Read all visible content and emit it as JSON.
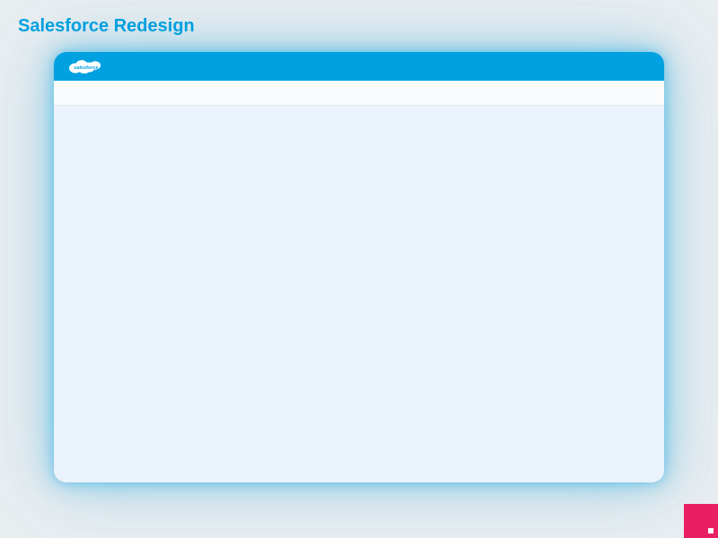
{
  "page": {
    "title": "Salesforce Redesign"
  },
  "header": {
    "logo_text": "salesforce"
  },
  "colors": {
    "brand": "#00a1e0",
    "accent": "#ea1e63"
  }
}
